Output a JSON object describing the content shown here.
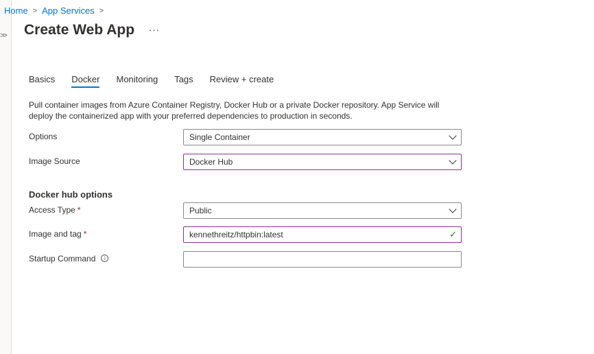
{
  "breadcrumb": {
    "items": [
      "Home",
      "App Services"
    ]
  },
  "header": {
    "title": "Create Web App",
    "more": "···"
  },
  "tabs": [
    {
      "label": "Basics",
      "active": false
    },
    {
      "label": "Docker",
      "active": true
    },
    {
      "label": "Monitoring",
      "active": false
    },
    {
      "label": "Tags",
      "active": false
    },
    {
      "label": "Review + create",
      "active": false
    }
  ],
  "docker": {
    "description": "Pull container images from Azure Container Registry, Docker Hub or a private Docker repository. App Service will deploy the containerized app with your preferred dependencies to production in seconds.",
    "options": {
      "label": "Options",
      "value": "Single Container"
    },
    "image_source": {
      "label": "Image Source",
      "value": "Docker Hub"
    },
    "hub_section_title": "Docker hub options",
    "access_type": {
      "label": "Access Type",
      "required": "*",
      "value": "Public"
    },
    "image_tag": {
      "label": "Image and tag",
      "required": "*",
      "value": "kennethreitz/httpbin:latest"
    },
    "startup_command": {
      "label": "Startup Command",
      "value": ""
    }
  },
  "icons": {
    "expand": "double-chevron-right-icon",
    "breadcrumb_separator": "chevron-right-icon",
    "more": "more-horizontal-icon",
    "dropdown": "chevron-down-icon",
    "valid": "checkmark-icon",
    "info": "info-icon"
  },
  "colors": {
    "link": "#0078d4",
    "focus_border": "#8a2f9a",
    "valid": "#107c10",
    "required": "#a4262c"
  }
}
